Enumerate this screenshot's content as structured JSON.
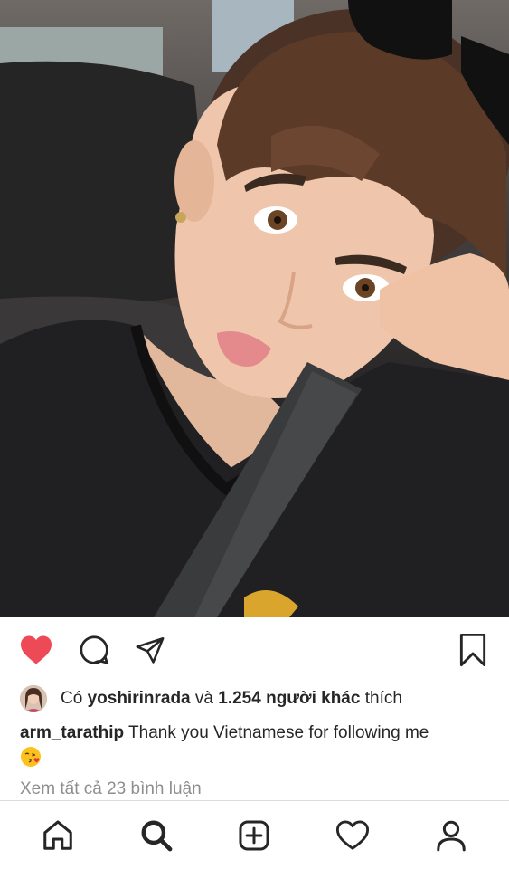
{
  "post": {
    "liked": true,
    "likes": {
      "prefix": "Có",
      "user": "yoshirinrada",
      "connector": "và",
      "count": "1.254 người khác",
      "suffix": "thích"
    },
    "caption": {
      "username": "arm_tarathip",
      "text": "Thank you Vietnamese for following me",
      "emoji": "kissing-face-with-heart-emoji"
    },
    "view_comments": "Xem tất cả 23 bình luận"
  },
  "icons": {
    "like": "heart-filled-icon",
    "comment": "comment-bubble-icon",
    "share": "paper-plane-icon",
    "save": "bookmark-icon",
    "nav": [
      "home-icon",
      "search-icon",
      "add-post-icon",
      "activity-heart-icon",
      "profile-icon"
    ]
  },
  "colors": {
    "like_red": "#ed4956",
    "text": "#262626",
    "muted": "#8e8e8e",
    "divider": "#dbdbdb"
  }
}
